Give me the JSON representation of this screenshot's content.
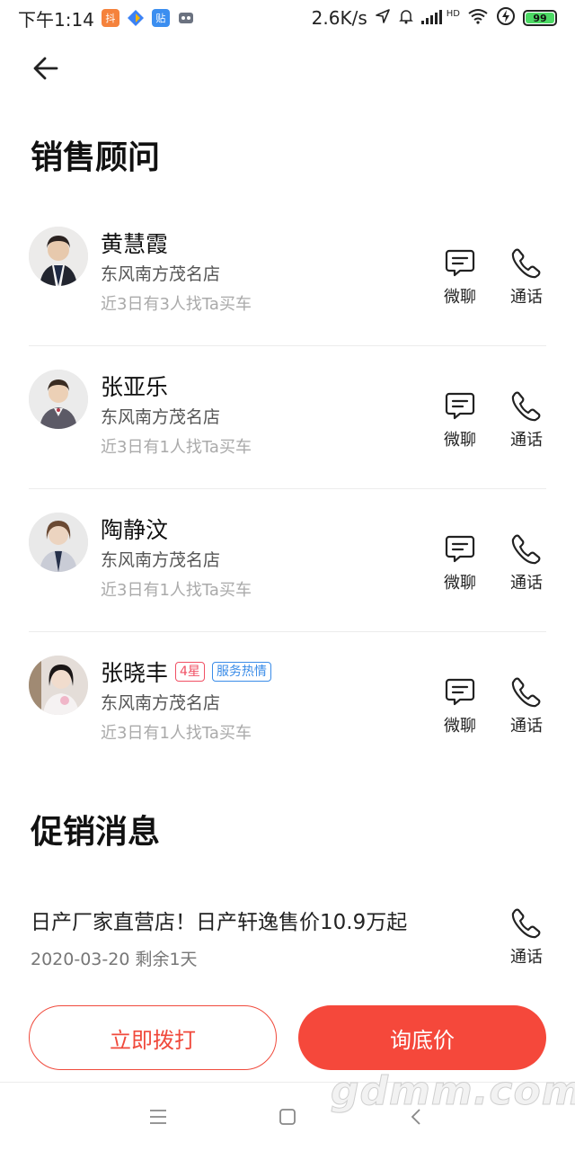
{
  "status_bar": {
    "time": "下午1:14",
    "net_speed": "2.6K/s",
    "signal_label": "HD",
    "battery": "99",
    "app_badge_1": "抖",
    "app_badge_2": "贴"
  },
  "sections": {
    "advisors_title": "销售顾问",
    "promo_title": "促销消息"
  },
  "advisors": [
    {
      "name": "黄慧霞",
      "store": "东风南方茂名店",
      "stat": "近3日有3人找Ta买车",
      "chat_label": "微聊",
      "call_label": "通话"
    },
    {
      "name": "张亚乐",
      "store": "东风南方茂名店",
      "stat": "近3日有1人找Ta买车",
      "chat_label": "微聊",
      "call_label": "通话"
    },
    {
      "name": "陶静汶",
      "store": "东风南方茂名店",
      "stat": "近3日有1人找Ta买车",
      "chat_label": "微聊",
      "call_label": "通话"
    },
    {
      "name": "张晓丰",
      "rating_tag": "4星",
      "service_tag": "服务热情",
      "store": "东风南方茂名店",
      "stat": "近3日有1人找Ta买车",
      "chat_label": "微聊",
      "call_label": "通话"
    }
  ],
  "promotion": {
    "title": "日产厂家直营店！日产轩逸售价10.9万起",
    "date": "2020-03-20 剩余1天",
    "call_label": "通话"
  },
  "buttons": {
    "call_now": "立即拨打",
    "inquiry": "询底价"
  },
  "watermark": "gdmm.com",
  "colors": {
    "accent": "#f5483b",
    "rating_tag": "#f05064",
    "service_tag": "#3a8ce8"
  }
}
